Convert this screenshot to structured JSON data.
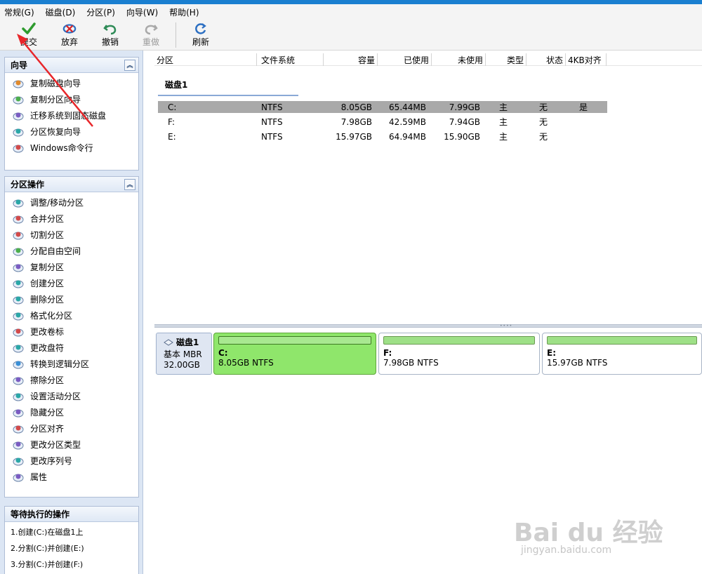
{
  "menu": [
    "常规(G)",
    "磁盘(D)",
    "分区(P)",
    "向导(W)",
    "帮助(H)"
  ],
  "toolbar": {
    "apply": "提交",
    "discard": "放弃",
    "undo": "撤销",
    "redo": "重做",
    "refresh": "刷新"
  },
  "wizard_panel": {
    "title": "向导",
    "items": [
      {
        "label": "复制磁盘向导",
        "icon": "copy-disk-icon"
      },
      {
        "label": "复制分区向导",
        "icon": "copy-partition-icon"
      },
      {
        "label": "迁移系统到固态磁盘",
        "icon": "migrate-os-icon"
      },
      {
        "label": "分区恢复向导",
        "icon": "partition-recovery-icon"
      },
      {
        "label": "Windows命令行",
        "icon": "globe-icon"
      }
    ]
  },
  "partition_panel": {
    "title": "分区操作",
    "items": [
      {
        "label": "调整/移动分区",
        "icon": "resize-icon"
      },
      {
        "label": "合并分区",
        "icon": "merge-icon"
      },
      {
        "label": "切割分区",
        "icon": "split-icon"
      },
      {
        "label": "分配自由空间",
        "icon": "allocate-icon"
      },
      {
        "label": "复制分区",
        "icon": "copy-icon"
      },
      {
        "label": "创建分区",
        "icon": "create-icon"
      },
      {
        "label": "删除分区",
        "icon": "delete-icon"
      },
      {
        "label": "格式化分区",
        "icon": "format-icon"
      },
      {
        "label": "更改卷标",
        "icon": "label-icon"
      },
      {
        "label": "更改盘符",
        "icon": "drive-letter-icon"
      },
      {
        "label": "转换到逻辑分区",
        "icon": "convert-icon"
      },
      {
        "label": "擦除分区",
        "icon": "wipe-icon"
      },
      {
        "label": "设置活动分区",
        "icon": "active-icon"
      },
      {
        "label": "隐藏分区",
        "icon": "hide-icon"
      },
      {
        "label": "分区对齐",
        "icon": "align-icon"
      },
      {
        "label": "更改分区类型",
        "icon": "type-icon"
      },
      {
        "label": "更改序列号",
        "icon": "serial-icon"
      },
      {
        "label": "属性",
        "icon": "info-icon"
      }
    ]
  },
  "pending_panel": {
    "title": "等待执行的操作",
    "items": [
      "1.创建(C:)在磁盘1上",
      "2.分割(C:)并创建(E:)",
      "3.分割(C:)并创建(F:)"
    ]
  },
  "table": {
    "columns": [
      "分区",
      "文件系统",
      "容量",
      "已使用",
      "未使用",
      "类型",
      "状态",
      "4KB对齐"
    ],
    "disk_label": "磁盘1",
    "rows": [
      [
        "C:",
        "NTFS",
        "8.05GB",
        "65.44MB",
        "7.99GB",
        "主",
        "无",
        "是"
      ],
      [
        "F:",
        "NTFS",
        "7.98GB",
        "42.59MB",
        "7.94GB",
        "主",
        "无",
        ""
      ],
      [
        "E:",
        "NTFS",
        "15.97GB",
        "64.94MB",
        "15.90GB",
        "主",
        "无",
        ""
      ]
    ]
  },
  "diskmap": {
    "disk_name": "磁盘1",
    "disk_type": "基本 MBR",
    "disk_size": "32.00GB",
    "partitions": [
      {
        "letter": "C:",
        "info": "8.05GB NTFS"
      },
      {
        "letter": "F:",
        "info": "7.98GB NTFS"
      },
      {
        "letter": "E:",
        "info": "15.97GB NTFS"
      }
    ]
  },
  "watermark": {
    "main": "Bai du 经验",
    "sub": "jingyan.baidu.com"
  },
  "colors": {
    "accent": "#1a7fd0",
    "active_partition": "#8fe66b",
    "selected_row": "#a9a9a9",
    "annotation_arrow": "#e8262a"
  }
}
